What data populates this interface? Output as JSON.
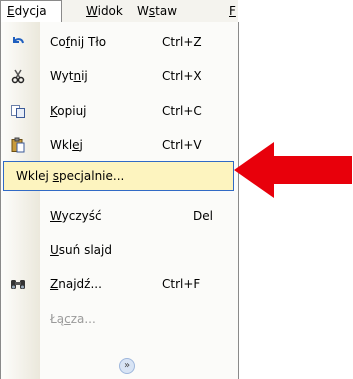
{
  "menubar": {
    "items": [
      {
        "label": "Edycja"
      },
      {
        "label": "Widok"
      },
      {
        "label": "Wstaw"
      },
      {
        "label": "F"
      }
    ]
  },
  "menu": {
    "items": [
      {
        "label": "Cofnij Tło",
        "shortcut": "Ctrl+Z",
        "icon": "undo-icon"
      },
      {
        "label": "Wytnij",
        "shortcut": "Ctrl+X",
        "icon": "scissors-icon"
      },
      {
        "label": "Kopiuj",
        "shortcut": "Ctrl+C",
        "icon": "copy-icon"
      },
      {
        "label": "Wklej",
        "shortcut": "Ctrl+V",
        "icon": "paste-icon"
      },
      {
        "label": "Wklej specjalnie...",
        "shortcut": "",
        "highlighted": true
      },
      {
        "label": "Wyczyść",
        "shortcut": "Del"
      },
      {
        "label": "Usuń slajd",
        "shortcut": ""
      },
      {
        "label": "Znajdź...",
        "shortcut": "Ctrl+F",
        "icon": "binoculars-icon"
      },
      {
        "label": "Łącza...",
        "shortcut": "",
        "disabled": true
      }
    ],
    "expand_icon": "chevron-double-down-icon"
  },
  "colors": {
    "highlight": "#fdf4bf",
    "highlight_border": "#316ac5",
    "arrow": "#e8000b"
  }
}
